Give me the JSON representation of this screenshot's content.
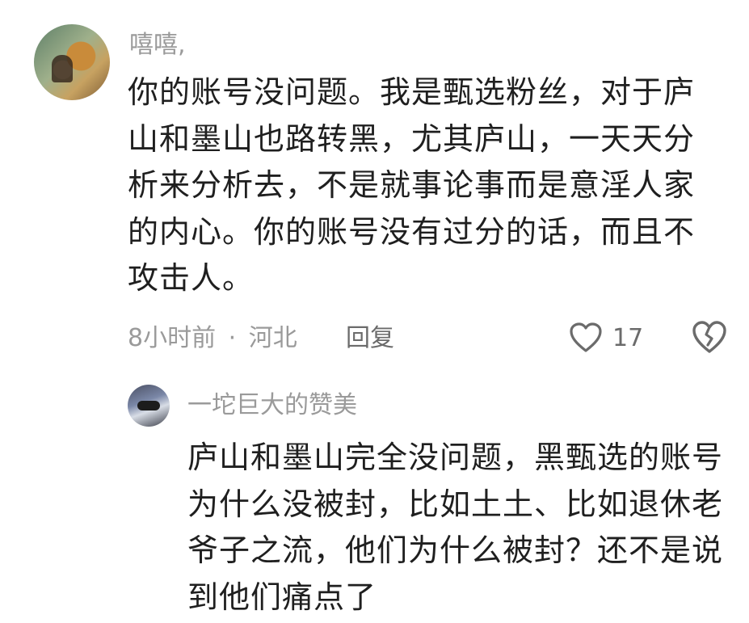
{
  "comment": {
    "username": "嘻嘻,",
    "lines": [
      "你的账号没问题。我是甄选粉丝，对于庐",
      "山和墨山也路转黑，尤其庐山，一天天分",
      "析来分析去，不是就事论事而是意淫人家",
      "的内心。你的账号没有过分的话，而且不",
      "攻击人。"
    ],
    "time": "8小时前",
    "separator": "·",
    "location": "河北",
    "reply_label": "回复",
    "like_count": "17"
  },
  "reply": {
    "username": "一坨巨大的赞美",
    "lines": [
      "庐山和墨山完全没问题，黑甄选的账号",
      "为什么没被封，比如土土、比如退休老",
      "爷子之流，他们为什么被封？还不是说",
      "到他们痛点了"
    ]
  },
  "icons": {
    "like": "heart-outline-icon",
    "dislike": "broken-heart-icon"
  }
}
